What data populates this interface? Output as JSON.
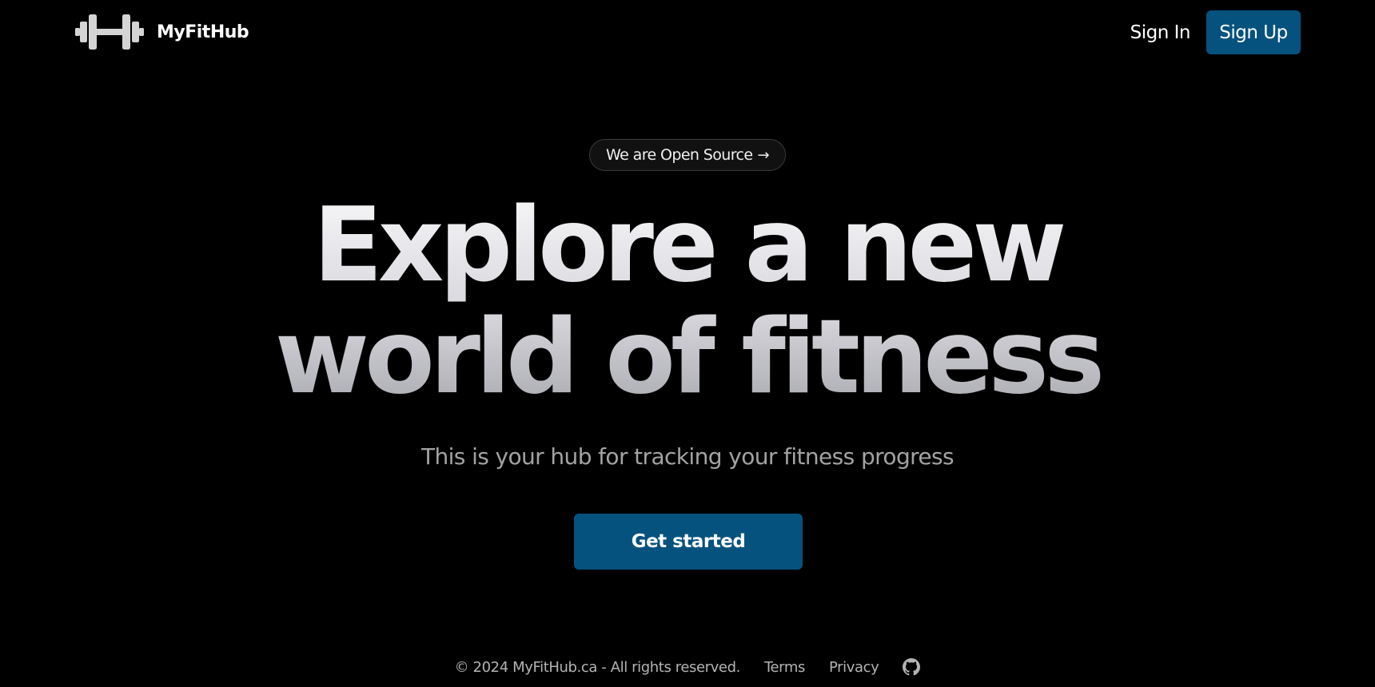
{
  "header": {
    "brand": "MyFitHub",
    "logo_icon": "dumbbell-icon",
    "nav": {
      "sign_in": "Sign In",
      "sign_up": "Sign Up"
    }
  },
  "hero": {
    "badge": "We are Open Source",
    "badge_icon": "arrow-right-icon",
    "headline_line1": "Explore a new",
    "headline_line2": "world of fitness",
    "subtitle": "This is your hub for tracking your fitness progress",
    "cta": "Get started"
  },
  "footer": {
    "copyright": "© 2024 MyFitHub.ca - All rights reserved.",
    "terms": "Terms",
    "privacy": "Privacy",
    "github_icon": "github-icon"
  },
  "colors": {
    "background": "#000000",
    "accent": "#06527f",
    "muted_text": "#a3a3a3"
  }
}
